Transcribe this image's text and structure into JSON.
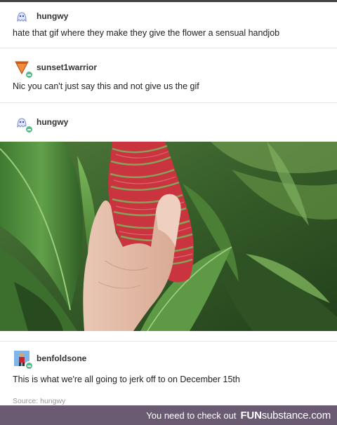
{
  "posts": [
    {
      "username": "hungwy",
      "text": "hate that gif where they make they give the flower a sensual handjob",
      "avatar_icon": "ghost-icon"
    },
    {
      "username": "sunset1warrior",
      "text": "Nic you can't just say this and not give us the gif",
      "avatar_icon": "pizza-slice-icon"
    },
    {
      "username": "hungwy",
      "text": "",
      "avatar_icon": "ghost-icon"
    },
    {
      "username": "benfoldsone",
      "text": "This is what we're all going to jerk off to on December 15th",
      "avatar_icon": "figure-icon"
    }
  ],
  "source": "Source: hungwy",
  "footer": {
    "cta": "You need to check out",
    "brand_bold": "FUN",
    "brand_rest": "substance.com"
  },
  "colors": {
    "footer_bg": "#6a5a72",
    "follow_badge": "#56bc8a"
  }
}
